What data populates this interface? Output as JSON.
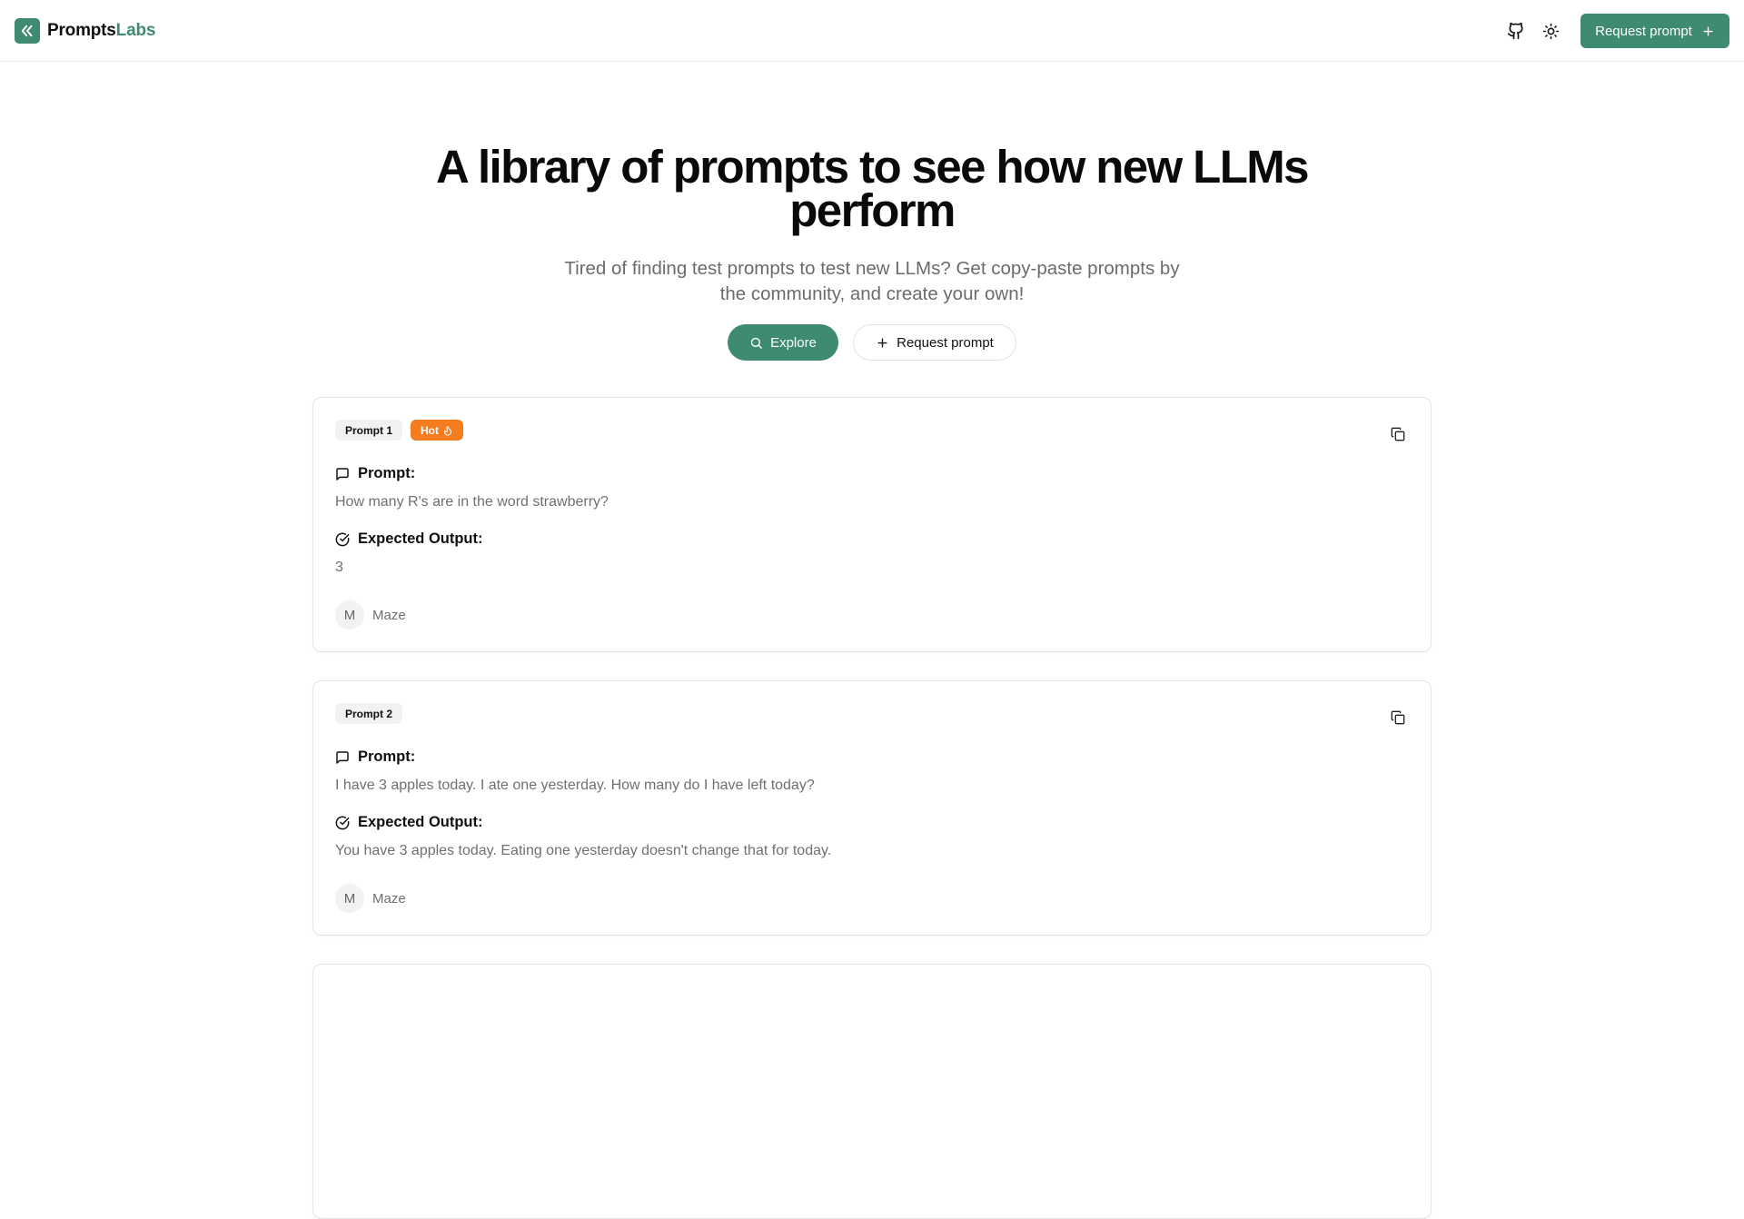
{
  "header": {
    "brand_primary": "Prompts",
    "brand_accent": "Labs",
    "request_label": "Request prompt",
    "icons": [
      "github-icon",
      "sun-icon",
      "plus-icon"
    ]
  },
  "hero": {
    "title": "A library of prompts to see how new LLMs perform",
    "subtitle": "Tired of finding test prompts to test new LLMs? Get copy-paste prompts by the community, and create your own!",
    "explore_label": "Explore",
    "request_label": "Request prompt"
  },
  "labels": {
    "prompt": "Prompt:",
    "expected": "Expected Output:"
  },
  "cards": [
    {
      "badge": "Prompt 1",
      "hot_label": "Hot",
      "prompt": "How many R's are in the word strawberry?",
      "expected": "3",
      "author_initial": "M",
      "author": "Maze"
    },
    {
      "badge": "Prompt 2",
      "prompt": "I have 3 apples today. I ate one yesterday. How many do I have left today?",
      "expected": "You have 3 apples today. Eating one yesterday doesn't change that for today.",
      "author_initial": "M",
      "author": "Maze"
    }
  ],
  "colors": {
    "brand": "#3f8a73",
    "hot": "#f57c1f",
    "muted_text": "#707070",
    "border": "#e4e4e4"
  }
}
